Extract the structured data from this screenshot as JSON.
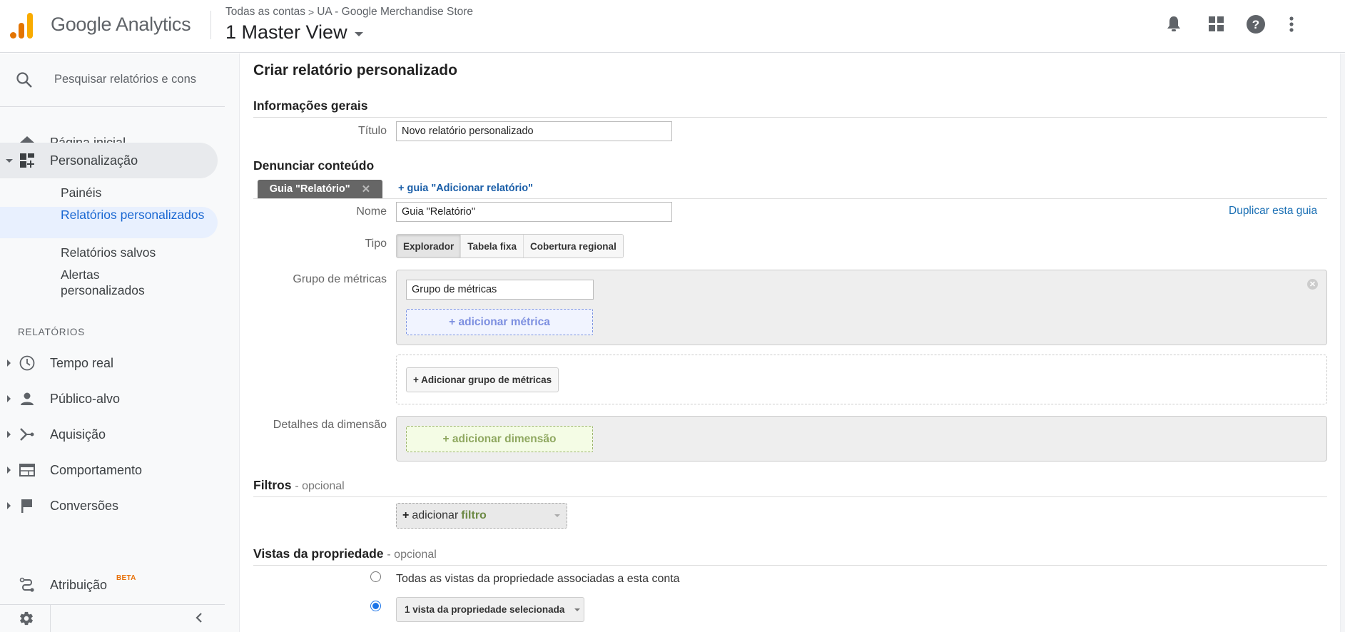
{
  "header": {
    "product_name": "Google Analytics",
    "breadcrumb": [
      "Todas as contas",
      "UA - Google Merchandise Store"
    ],
    "breadcrumb_separator": ">",
    "view_name": "1 Master View",
    "icons": [
      "notifications-icon",
      "apps-grid-icon",
      "help-icon",
      "more-vert-icon"
    ],
    "logo_colors": {
      "dark": "#e37400",
      "light": "#f9ab00"
    }
  },
  "sidebar": {
    "search_placeholder": "Pesquisar relatórios e cons",
    "home_label": "Página inicial",
    "customization_label": "Personalização",
    "customization_items": [
      {
        "label": "Painéis",
        "selected": false
      },
      {
        "label": "Relatórios personalizados",
        "selected": true
      },
      {
        "label": "Relatórios salvos",
        "selected": false
      },
      {
        "label": "Alertas personalizados",
        "selected": false
      }
    ],
    "reports_section_label": "RELATÓRIOS",
    "reports": [
      {
        "label": "Tempo real",
        "icon": "clock-icon"
      },
      {
        "label": "Público-alvo",
        "icon": "person-icon"
      },
      {
        "label": "Aquisição",
        "icon": "acquisition-icon"
      },
      {
        "label": "Comportamento",
        "icon": "behavior-icon"
      },
      {
        "label": "Conversões",
        "icon": "flag-icon"
      }
    ],
    "attribution_label": "Atribuição",
    "attribution_badge": "BETA",
    "accent_color": "#1967d2"
  },
  "main": {
    "page_title": "Criar relatório personalizado",
    "general": {
      "heading": "Informações gerais",
      "title_label": "Título",
      "title_value": "Novo relatório personalizado"
    },
    "content": {
      "heading": "Denunciar conteúdo",
      "active_tab": "Guia \"Relatório\"",
      "add_tab_link": "+ guia \"Adicionar relatório\"",
      "duplicate_link": "Duplicar esta guia",
      "name_label": "Nome",
      "name_value": "Guia \"Relatório\"",
      "type_label": "Tipo",
      "type_options": [
        "Explorador",
        "Tabela fixa",
        "Cobertura regional"
      ],
      "type_selected": "Explorador",
      "metric_group_label": "Grupo de métricas",
      "metric_group_name": "Grupo de métricas",
      "add_metric": "+ adicionar métrica",
      "add_metric_group": "+ Adicionar grupo de métricas",
      "dimension_label": "Detalhes da dimensão",
      "add_dimension": "+ adicionar dimensão"
    },
    "filters": {
      "heading": "Filtros",
      "optional": "- opcional",
      "add_prefix": "+",
      "add_text": "adicionar",
      "add_keyword": "filtro"
    },
    "views": {
      "heading": "Vistas da propriedade",
      "optional": "- opcional",
      "option_all": "Todas as vistas da propriedade associadas a esta conta",
      "option_selected_value": "1 vista da propriedade selecionada",
      "selected_option": "selected"
    }
  }
}
